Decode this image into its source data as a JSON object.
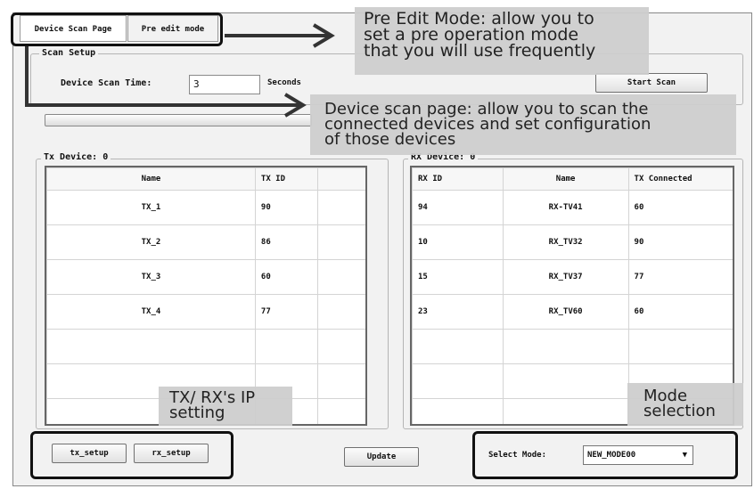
{
  "tabs": {
    "scan": "Device Scan Page",
    "pre_edit": "Pre edit mode"
  },
  "scan_setup": {
    "legend": "Scan Setup",
    "time_label": "Device Scan Time:",
    "time_value": "3",
    "seconds": "Seconds",
    "start_button": "Start Scan"
  },
  "tx": {
    "legend": "Tx Device: 0",
    "headers": [
      "Name",
      "TX ID",
      ""
    ],
    "rows": [
      [
        "TX_1",
        "90",
        ""
      ],
      [
        "TX_2",
        "86",
        ""
      ],
      [
        "TX_3",
        "60",
        ""
      ],
      [
        "TX_4",
        "77",
        ""
      ],
      [
        "",
        "",
        ""
      ],
      [
        "",
        "",
        ""
      ],
      [
        "",
        "",
        ""
      ]
    ]
  },
  "rx": {
    "legend": "RX Device: 0",
    "headers": [
      "RX ID",
      "Name",
      "TX Connected"
    ],
    "rows": [
      [
        "94",
        "RX-TV41",
        "60"
      ],
      [
        "10",
        "RX_TV32",
        "90"
      ],
      [
        "15",
        "RX_TV37",
        "77"
      ],
      [
        "23",
        "RX_TV60",
        "60"
      ],
      [
        "",
        "",
        ""
      ],
      [
        "",
        "",
        ""
      ],
      [
        "",
        "",
        ""
      ]
    ]
  },
  "bottom": {
    "tx_setup": "tx_setup",
    "rx_setup": "rx_setup",
    "update": "Update",
    "select_mode_label": "Select Mode:",
    "select_mode_value": "NEW_MODE00"
  },
  "annotations": {
    "pre_edit": [
      "Pre Edit Mode: allow you to",
      "set a pre operation mode",
      "that you will use frequently"
    ],
    "scan_page": [
      "Device scan page:  allow you to scan the",
      "connected devices and set configuration",
      "of those devices"
    ],
    "ip": [
      "TX/ RX's IP",
      "setting"
    ],
    "mode": [
      "Mode",
      "selection"
    ]
  }
}
